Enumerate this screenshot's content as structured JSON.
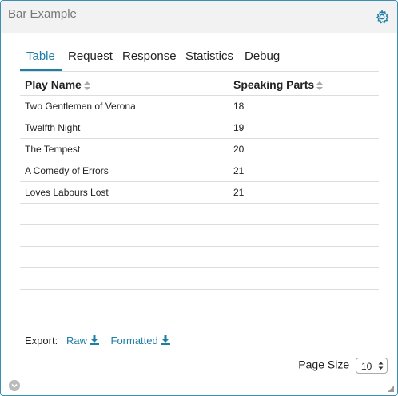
{
  "panel": {
    "title": "Bar Example"
  },
  "tabs": [
    {
      "label": "Table",
      "active": true
    },
    {
      "label": "Request"
    },
    {
      "label": "Response"
    },
    {
      "label": "Statistics"
    },
    {
      "label": "Debug"
    }
  ],
  "table": {
    "headers": [
      "Play Name",
      "Speaking Parts"
    ],
    "rows": [
      [
        "Two Gentlemen of Verona",
        "18"
      ],
      [
        "Twelfth Night",
        "19"
      ],
      [
        "The Tempest",
        "20"
      ],
      [
        "A Comedy of Errors",
        "21"
      ],
      [
        "Loves Labours Lost",
        "21"
      ]
    ]
  },
  "export": {
    "label": "Export:",
    "raw": "Raw",
    "formatted": "Formatted"
  },
  "paging": {
    "label": "Page Size",
    "value": "10"
  },
  "colors": {
    "accent": "#1d7ea6",
    "border": "#3b8fb0",
    "header_bg": "#f2f2f2"
  },
  "icons": {
    "settings": "gear-icon",
    "sort": "sort-icon",
    "download": "download-icon",
    "collapse": "chevron-down-icon",
    "resize": "resize-grip-icon"
  }
}
